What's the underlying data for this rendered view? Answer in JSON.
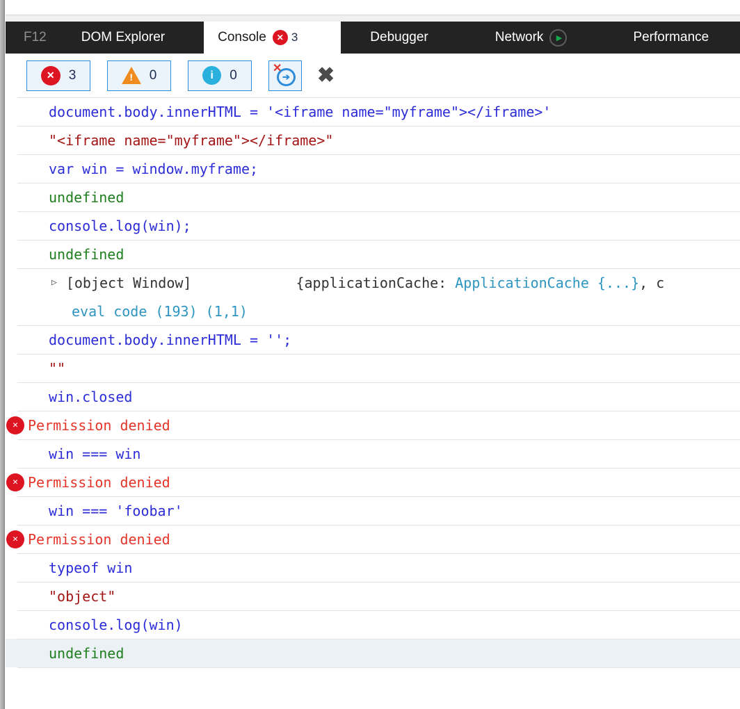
{
  "colors": {
    "accent": "#2F8CD9",
    "btn_bg": "#EBF3FB",
    "input_blue": "#2C2CD8",
    "string_red": "#A31515",
    "undefined_green": "#1E7E1E",
    "error_red": "#E5352B",
    "object_teal": "#2E95C0",
    "badge_red": "#DD1522",
    "warning_orange": "#EF8B1F",
    "info_cyan": "#29B0DD",
    "play_green": "#16A94C",
    "selected_row_bg": "#ECF1F6"
  },
  "tabs": {
    "f12": "F12",
    "dom_explorer": "DOM Explorer",
    "console": "Console",
    "console_error_count": "3",
    "debugger": "Debugger",
    "network": "Network",
    "performance": "Performance"
  },
  "toolbar": {
    "error_count": "3",
    "warning_count": "0",
    "info_count": "0"
  },
  "console": {
    "rows": [
      {
        "type": "input",
        "text": "document.body.innerHTML = '<iframe name=\"myframe\"></iframe>'"
      },
      {
        "type": "string",
        "text": "\"<iframe name=\"myframe\"></iframe>\""
      },
      {
        "type": "input",
        "text": "var win = window.myframe;"
      },
      {
        "type": "undefined",
        "text": "undefined"
      },
      {
        "type": "input",
        "text": "console.log(win);"
      },
      {
        "type": "undefined",
        "text": "undefined"
      },
      {
        "type": "object",
        "label": "[object Window]",
        "preview_prefix": "{applicationCache: ",
        "preview_class": "ApplicationCache {...}",
        "preview_suffix": ", c",
        "source": "eval code (193) (1,1)"
      },
      {
        "type": "input",
        "text": "document.body.innerHTML = '';"
      },
      {
        "type": "string",
        "text": "\"\""
      },
      {
        "type": "input",
        "text": "win.closed"
      },
      {
        "type": "error",
        "text": "Permission denied"
      },
      {
        "type": "input",
        "text": "win === win"
      },
      {
        "type": "error",
        "text": "Permission denied"
      },
      {
        "type": "input",
        "text": "win === 'foobar'"
      },
      {
        "type": "error",
        "text": "Permission denied"
      },
      {
        "type": "input",
        "text": "typeof win"
      },
      {
        "type": "string",
        "text": "\"object\""
      },
      {
        "type": "input",
        "text": "console.log(win)"
      },
      {
        "type": "undefined",
        "text": "undefined",
        "selected": true
      }
    ]
  }
}
